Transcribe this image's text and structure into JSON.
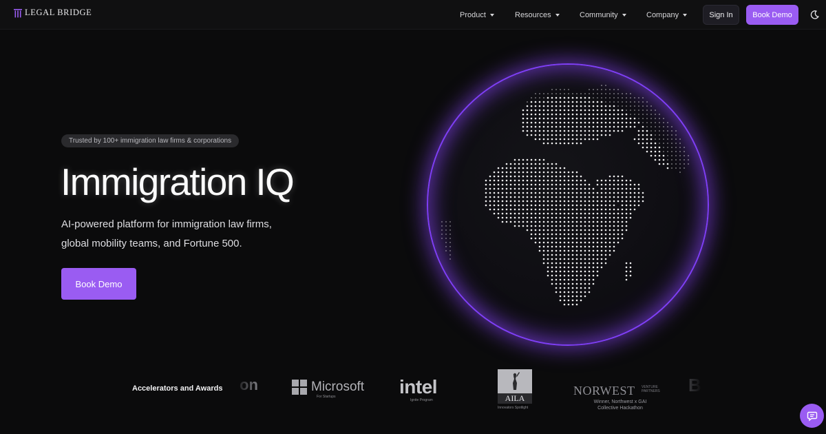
{
  "brand": {
    "name": "LEGAL BRIDGE",
    "accent": "#9a5cf2"
  },
  "nav": {
    "items": [
      {
        "label": "Product"
      },
      {
        "label": "Resources"
      },
      {
        "label": "Community"
      },
      {
        "label": "Company"
      }
    ],
    "sign_in": "Sign In",
    "book_demo": "Book Demo",
    "theme_icon": "moon-icon"
  },
  "hero": {
    "badge": "Trusted by 100+ immigration law firms & corporations",
    "title": "Immigration IQ",
    "subtitle_lines": [
      "AI-powered platform for immigration law firms,",
      "global mobility teams, and Fortune 500."
    ],
    "cta": "Book Demo",
    "visual": "dotted-globe-africa-europe"
  },
  "awards": {
    "label": "Accelerators and Awards",
    "logos": [
      {
        "name": "on"
      },
      {
        "name": "Microsoft",
        "sub": "For Startups"
      },
      {
        "name": "intel",
        "sub": "Ignite Program"
      },
      {
        "name": "AILA",
        "sub": "Innovators Spotlight"
      },
      {
        "name": "NORWEST",
        "tag": "VENTURE PARTNERS",
        "sub": "Winner, Northwest x GAI Collective Hackathon"
      },
      {
        "name": "B"
      }
    ]
  },
  "chat": {
    "icon": "chat-icon"
  }
}
